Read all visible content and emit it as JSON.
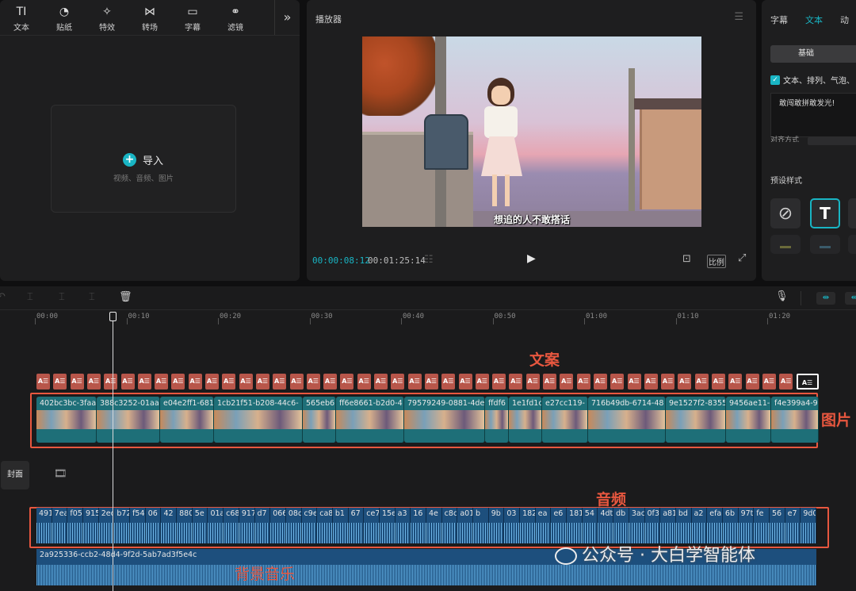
{
  "left_tabs": [
    {
      "icon": "TI",
      "label": "文本",
      "name": "text"
    },
    {
      "icon": "◔",
      "label": "贴纸",
      "name": "sticker"
    },
    {
      "icon": "✧",
      "label": "特效",
      "name": "effects"
    },
    {
      "icon": "⋈",
      "label": "转场",
      "name": "transition"
    },
    {
      "icon": "▭",
      "label": "字幕",
      "name": "captions"
    },
    {
      "icon": "⚭",
      "label": "滤镜",
      "name": "filters"
    }
  ],
  "left_more": "»",
  "import": {
    "label": "导入",
    "sub": "视频、音频、图片"
  },
  "player": {
    "title": "播放器",
    "subtitle": "想追的人不敢搭话",
    "time_current": "00:00:08:12",
    "time_total": "00:01:25:14",
    "ratio": "比例"
  },
  "right": {
    "tabs": [
      "字幕",
      "文本",
      "动"
    ],
    "active_tab": 1,
    "basic": "基础",
    "checkbox_label": "文本、排列、气泡、",
    "text_value": "敢闯敢拼敢发光!",
    "align_label": "对齐方式",
    "preset_label": "预设样式"
  },
  "ruler": [
    "00:00",
    "00:10",
    "00:20",
    "00:30",
    "00:40",
    "00:50",
    "01:00",
    "01:10",
    "01:20"
  ],
  "annotations": {
    "text_track": "文案",
    "image_track": "图片",
    "audio_track": "音频",
    "bgm_track": "背景音乐"
  },
  "text_clip_label": "A☰",
  "image_clips": [
    "402bc3bc-3faa",
    "388c3252-01aa",
    "e04e2ff1-681",
    "1cb21f51-b208-44c6-",
    "565eb6",
    "ff6e8661-b2d0-4",
    "79579249-0881-4de",
    "ffdf6",
    "1e1fd1c",
    "e27cc119-",
    "716b49db-6714-48",
    "9e1527f2-8355",
    "9456ae11-",
    "f4e399a4-9"
  ],
  "audio_clips": [
    "491",
    "7ea",
    "f05",
    "915",
    "2ec",
    "b72",
    "f54",
    "06",
    "42",
    "880",
    "5e",
    "01a",
    "c68",
    "917",
    "d7",
    "066",
    "08d",
    "c9e",
    "ca8",
    "b1",
    "67",
    "ce74",
    "15e",
    "a3",
    "16",
    "4e",
    "c8cc",
    "a01",
    "b",
    "9b",
    "03",
    "182",
    "ea",
    "e6",
    "181",
    "54",
    "4dt",
    "db",
    "3ac",
    "0f3",
    "a81",
    "bd",
    "a2",
    "efa",
    "6b",
    "97t",
    "fe",
    "56",
    "e7",
    "9d02"
  ],
  "cover_label": "封面",
  "bgm_name": "2a925336-ccb2-48d4-9f2d-5ab7ad3f5e4c",
  "watermark": "公众号 · 大白学智能体",
  "accent": "#19b5c4",
  "annotation_color": "#e8573f"
}
